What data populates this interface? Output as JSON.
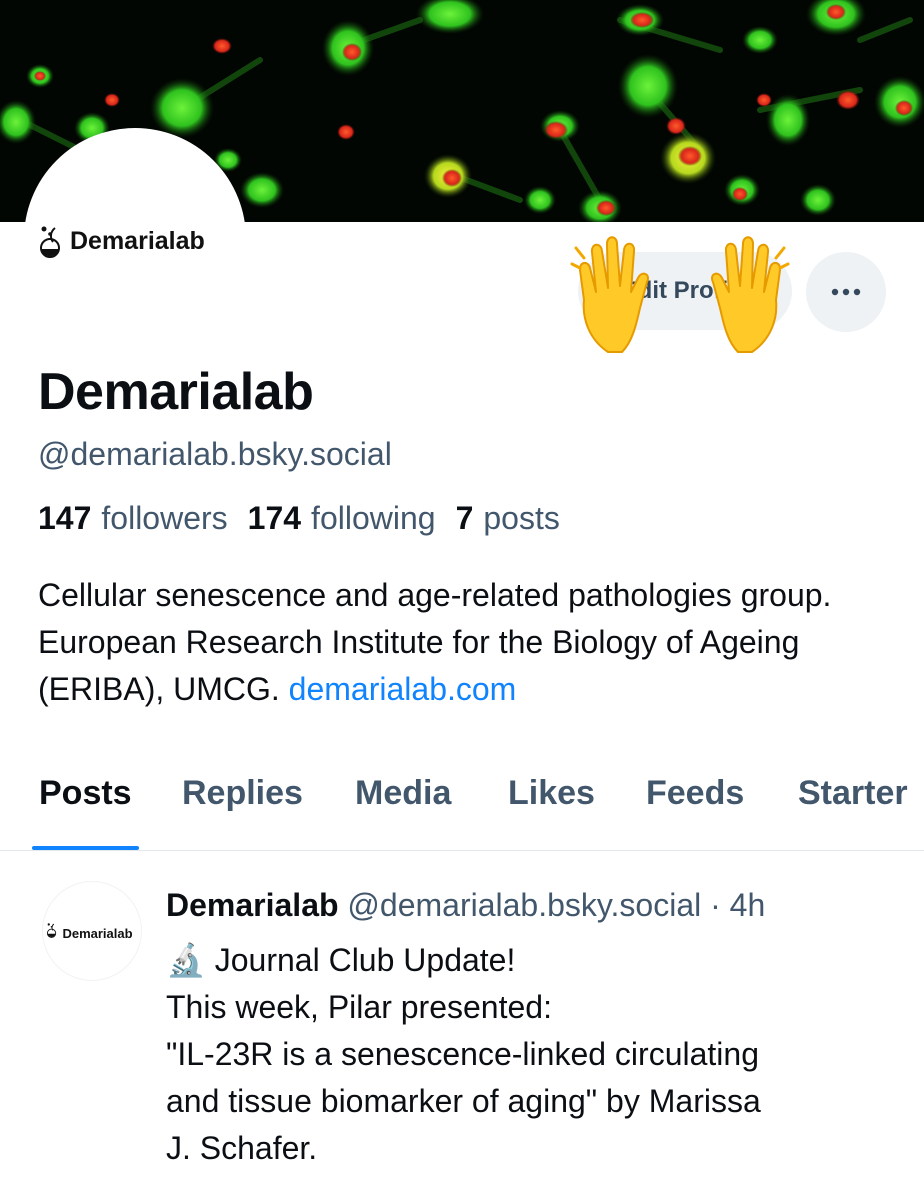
{
  "profile": {
    "logo_text": "Demarialab",
    "display_name": "Demarialab",
    "handle": "@demarialab.bsky.social",
    "edit_button": "Edit Profile",
    "stats": {
      "followers_count": "147",
      "followers_label": "followers",
      "following_count": "174",
      "following_label": "following",
      "posts_count": "7",
      "posts_label": "posts"
    },
    "bio_text": "Cellular senescence and age-related pathologies group. European Research Institute for the Biology of Ageing (ERIBA), UMCG. ",
    "bio_link": "demarialab.com"
  },
  "tabs": [
    {
      "label": "Posts",
      "active": true
    },
    {
      "label": "Replies"
    },
    {
      "label": "Media"
    },
    {
      "label": "Likes"
    },
    {
      "label": "Feeds"
    },
    {
      "label": "Starter"
    }
  ],
  "post": {
    "avatar_text": "Demarialab",
    "author": "Demarialab",
    "handle": "@demarialab.bsky.social",
    "separator": "·",
    "time": "4h",
    "lines": [
      "🔬 Journal Club Update!",
      "This week, Pilar presented:",
      "\"IL-23R is a senescence-linked circulating",
      "and tissue biomarker of aging\" by Marissa",
      "J. Schafer."
    ]
  },
  "icons": {
    "more": "more-horizontal-icon",
    "hands": "raised-hands-emoji",
    "flask": "flask-logo-icon",
    "microscope": "microscope-emoji"
  },
  "colors": {
    "accent": "#1083fe",
    "muted_text": "#42576c",
    "button_bg": "#eef2f5",
    "cell_green": "#37d62a",
    "cell_red": "#e8331f"
  }
}
